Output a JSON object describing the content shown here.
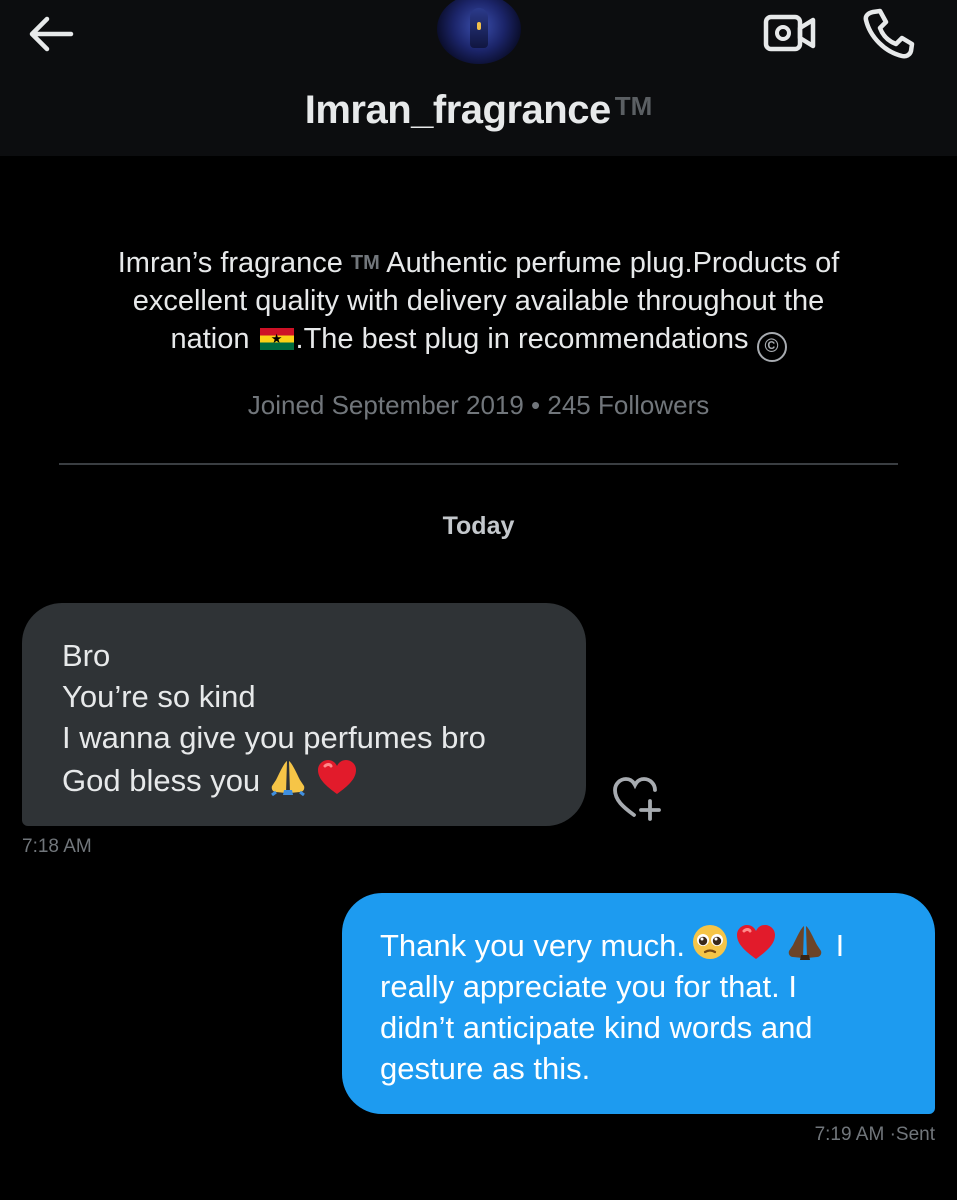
{
  "header": {
    "back_icon": "arrow-left-icon",
    "avatar_icon": "profile-avatar",
    "title": "Imran_fragrance",
    "title_tm": "TM",
    "video_icon": "video-call-icon",
    "call_icon": "phone-call-icon"
  },
  "profile": {
    "bio_line1_pre": "Imran’s fragrance ",
    "bio_tm": "TM",
    "bio_line1_post": "Authentic perfume plug.Products of",
    "bio_line2": "excellent quality with delivery available throughout the",
    "bio_line3_pre": "nation ",
    "bio_flag": "ghana-flag-icon",
    "bio_line3_post": ".The best plug in recommendations ",
    "bio_copyright": "©",
    "meta": "Joined September 2019 • 245 Followers"
  },
  "conversation": {
    "day_label": "Today",
    "messages": [
      {
        "direction": "incoming",
        "lines": [
          "Bro",
          "You’re so kind",
          "I wanna give you perfumes bro",
          "God bless you"
        ],
        "emojis": [
          "folded-hands-icon",
          "red-heart-icon"
        ],
        "time": "7:18 AM"
      },
      {
        "direction": "outgoing",
        "lines": [
          "Thank you very much.",
          "really appreciate you for that. I",
          "didn’t anticipate kind words and",
          "gesture as this."
        ],
        "line1_tail": "I",
        "emojis": [
          "pleading-face-icon",
          "red-heart-icon",
          "folded-hands-dark-icon"
        ],
        "time": "7:19 AM",
        "status": "Sent"
      }
    ],
    "react_icon": "add-reaction-heart-icon"
  },
  "colors": {
    "background": "#000000",
    "header_bg": "#0c0d0f",
    "incoming_bubble": "#2f3336",
    "outgoing_bubble": "#1d9bf0",
    "muted_text": "#71767b"
  }
}
